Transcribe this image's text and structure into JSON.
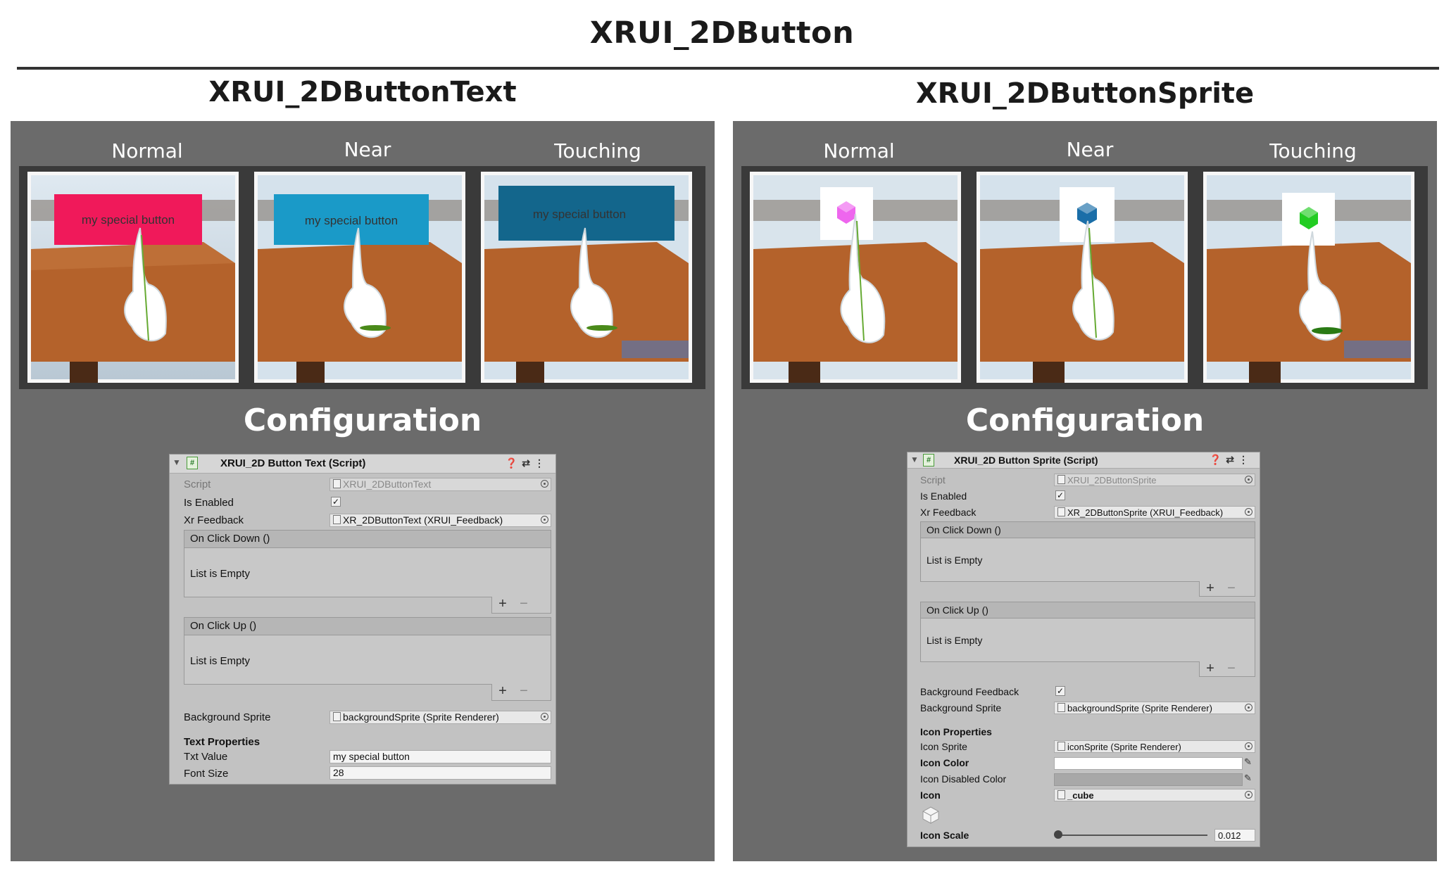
{
  "page": {
    "title": "XRUI_2DButton"
  },
  "sections": [
    {
      "title": "XRUI_2DButtonText",
      "states": [
        "Normal",
        "Near",
        "Touching"
      ],
      "button_text": "my special button",
      "button_colors": [
        "#f0195a",
        "#1a9ac8",
        "#13668c"
      ],
      "config_title": "Configuration",
      "inspector": {
        "header": "XRUI_2D Button Text (Script)",
        "script_label": "Script",
        "script_value": "XRUI_2DButtonText",
        "enabled_label": "Is Enabled",
        "enabled_check": "✓",
        "feedback_label": "Xr Feedback",
        "feedback_value": "XR_2DButtonText (XRUI_Feedback)",
        "click_down": "On Click Down ()",
        "click_up": "On Click Up ()",
        "list_empty": "List is Empty",
        "plus": "+",
        "minus": "−",
        "bg_sprite_label": "Background Sprite",
        "bg_sprite_value": "backgroundSprite (Sprite Renderer)",
        "text_props": "Text Properties",
        "txt_value_label": "Txt Value",
        "txt_value": "my special button",
        "font_size_label": "Font Size",
        "font_size": "28"
      }
    },
    {
      "title": "XRUI_2DButtonSprite",
      "states": [
        "Normal",
        "Near",
        "Touching"
      ],
      "icon_colors": [
        "#ee66ee",
        "#1a6ea8",
        "#22cc22"
      ],
      "config_title": "Configuration",
      "inspector": {
        "header": "XRUI_2D Button Sprite (Script)",
        "script_label": "Script",
        "script_value": "XRUI_2DButtonSprite",
        "enabled_label": "Is Enabled",
        "enabled_check": "✓",
        "feedback_label": "Xr Feedback",
        "feedback_value": "XR_2DButtonSprite (XRUI_Feedback)",
        "click_down": "On Click Down ()",
        "click_up": "On Click Up ()",
        "list_empty": "List is Empty",
        "plus": "+",
        "minus": "−",
        "bg_feedback_label": "Background Feedback",
        "bg_feedback_check": "✓",
        "bg_sprite_label": "Background Sprite",
        "bg_sprite_value": "backgroundSprite (Sprite Renderer)",
        "icon_props": "Icon Properties",
        "icon_sprite_label": "Icon Sprite",
        "icon_sprite_value": "iconSprite (Sprite Renderer)",
        "icon_color_label": "Icon Color",
        "icon_disabled_label": "Icon Disabled Color",
        "icon_label": "Icon",
        "icon_value": "_cube",
        "icon_scale_label": "Icon Scale",
        "icon_scale_value": "0.012",
        "icon_scale_fraction": 0.0
      }
    }
  ]
}
